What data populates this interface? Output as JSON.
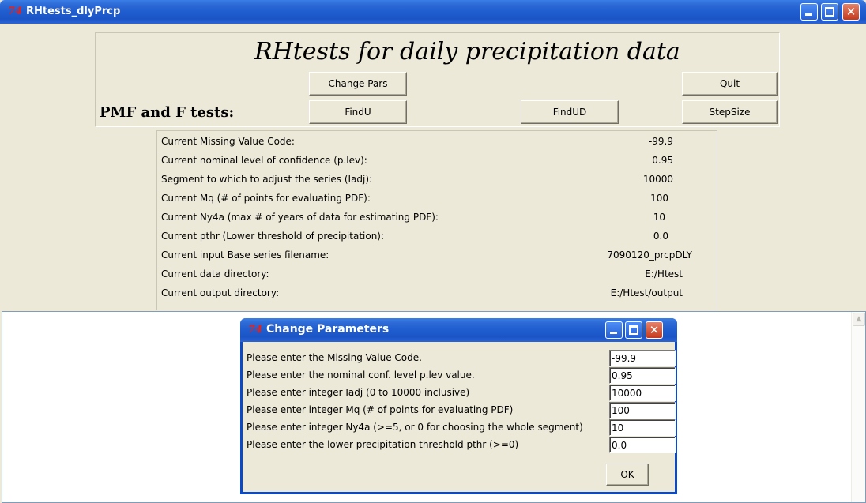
{
  "window": {
    "icon_text": "74",
    "title": "RHtests_dlyPrcp"
  },
  "header": {
    "title": "RHtests for daily precipitation data",
    "section_label": "PMF and F tests:",
    "buttons": {
      "change_pars": "Change Pars",
      "quit": "Quit",
      "find_u": "FindU",
      "find_ud": "FindUD",
      "step_size": "StepSize"
    }
  },
  "info": {
    "rows": [
      {
        "label": "Current Missing Value Code:",
        "value": "-99.9"
      },
      {
        "label": "Current nominal level of confidence (p.lev):",
        "value": "0.95"
      },
      {
        "label": "Segment to which to adjust the series (Iadj):",
        "value": "10000"
      },
      {
        "label": "Current Mq (# of points for evaluating PDF):",
        "value": "100"
      },
      {
        "label": "Current Ny4a (max # of years of data for estimating PDF):",
        "value": "10"
      },
      {
        "label": "Current pthr (Lower threshold of precipitation):",
        "value": "0.0"
      },
      {
        "label": "Current input Base series filename:",
        "value": "7090120_prcpDLY"
      },
      {
        "label": "Current data directory:",
        "value": "E:/Htest"
      },
      {
        "label": "Current output directory:",
        "value": "E:/Htest/output"
      }
    ]
  },
  "dialog": {
    "icon_text": "74",
    "title": "Change Parameters",
    "ok_label": "OK",
    "fields": [
      {
        "label": "Please enter the Missing Value Code.",
        "value": "-99.9"
      },
      {
        "label": "Please enter the nominal conf. level p.lev value.",
        "value": "0.95"
      },
      {
        "label": "Please enter integer Iadj (0 to 10000 inclusive)",
        "value": "10000"
      },
      {
        "label": "Please enter integer Mq (# of points for evaluating PDF)",
        "value": "100"
      },
      {
        "label": "Please enter integer Ny4a (>=5, or 0 for choosing the whole segment)",
        "value": "10"
      },
      {
        "label": "Please enter the lower precipitation threshold pthr (>=0)",
        "value": "0.0"
      }
    ]
  },
  "icons": [
    "tk-app-icon",
    "minimize-icon",
    "maximize-icon",
    "close-icon",
    "scroll-up-arrow-icon"
  ],
  "colors": {
    "titlebar": "#1f5dcf",
    "window_bg": "#ece9d8",
    "close_button": "#c6391c",
    "text_area_bg": "#ffffff"
  }
}
